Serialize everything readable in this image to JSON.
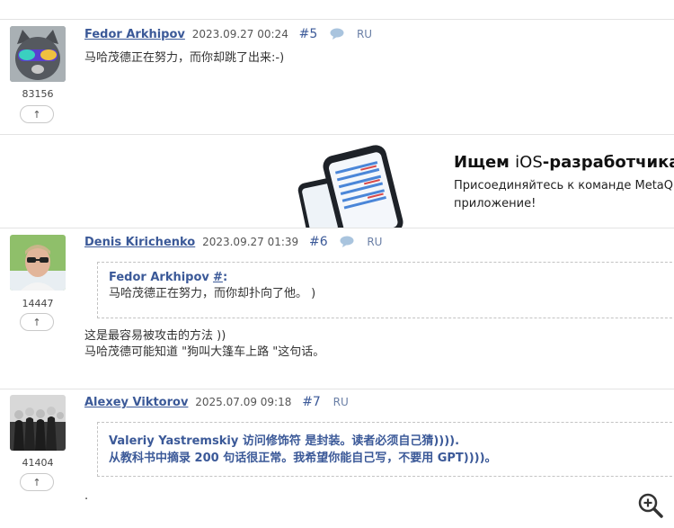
{
  "posts": [
    {
      "author": "Fedor Arkhipov",
      "date": "2023.09.27 00:24",
      "number": "#5",
      "lang": "RU",
      "rating": "83156",
      "vote": "↑",
      "text": "马哈茂德正在努力，而你却跳了出来:-)"
    },
    {
      "author": "Denis Kirichenko",
      "date": "2023.09.27 01:39",
      "number": "#6",
      "lang": "RU",
      "rating": "14447",
      "vote": "↑",
      "quote_author": "Fedor Arkhipov",
      "quote_link": "#",
      "quote_colon": ":",
      "quote_text": "马哈茂德正在努力，而你却扑向了他。 )",
      "text_lines": [
        "这是最容易被攻击的方法 ))",
        "马哈茂德可能知道 \"狗叫大篷车上路 \"这句话。"
      ]
    },
    {
      "author": "Alexey Viktorov",
      "date": "2025.07.09 09:18",
      "number": "#7",
      "lang": "RU",
      "rating": "41404",
      "vote": "↑",
      "quote_lines": [
        "Valeriy Yastremskiy 访问修饰符 是封装。读者必须自己猜)))).",
        "从教科书中摘录 200 句话很正常。我希望你能自己写，不要用 GPT))))。"
      ],
      "text": "."
    }
  ],
  "ad": {
    "title_bold": "Ищем ",
    "title_ios": "iOS",
    "title_rest": "-разработчика",
    "text_line1": "Присоединяйтесь к команде MetaQ",
    "text_line2": "приложение!"
  },
  "colors": {
    "link": "#3b5998",
    "border": "#c9c9c9",
    "separator": "#e3e3e3"
  },
  "icons": {
    "comment": "speech-bubble-icon",
    "vote": "arrow-up-icon",
    "zoom": "magnifier-plus-icon"
  }
}
